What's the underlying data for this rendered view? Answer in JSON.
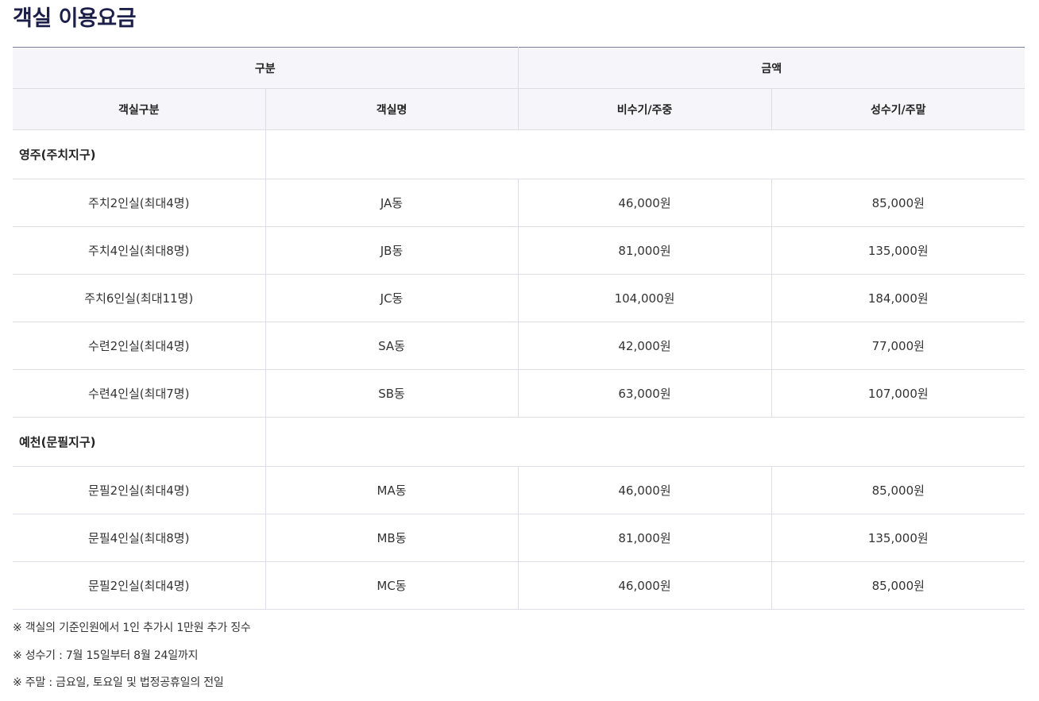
{
  "title": "객실 이용요금",
  "table": {
    "header_top": {
      "category": "구분",
      "amount": "금액"
    },
    "header_sub": {
      "room_type": "객실구분",
      "room_name": "객실명",
      "off_peak": "비수기/주중",
      "peak": "성수기/주말"
    },
    "groups": [
      {
        "name": "영주(주치지구)",
        "rooms": [
          {
            "type": "주치2인실(최대4명)",
            "name": "JA동",
            "off_peak": "46,000원",
            "peak": "85,000원"
          },
          {
            "type": "주치4인실(최대8명)",
            "name": "JB동",
            "off_peak": "81,000원",
            "peak": "135,000원"
          },
          {
            "type": "주치6인실(최대11명)",
            "name": "JC동",
            "off_peak": "104,000원",
            "peak": "184,000원"
          },
          {
            "type": "수련2인실(최대4명)",
            "name": "SA동",
            "off_peak": "42,000원",
            "peak": "77,000원"
          },
          {
            "type": "수련4인실(최대7명)",
            "name": "SB동",
            "off_peak": "63,000원",
            "peak": "107,000원"
          }
        ]
      },
      {
        "name": "예천(문필지구)",
        "rooms": [
          {
            "type": "문필2인실(최대4명)",
            "name": "MA동",
            "off_peak": "46,000원",
            "peak": "85,000원"
          },
          {
            "type": "문필4인실(최대8명)",
            "name": "MB동",
            "off_peak": "81,000원",
            "peak": "135,000원"
          },
          {
            "type": "문필2인실(최대4명)",
            "name": "MC동",
            "off_peak": "46,000원",
            "peak": "85,000원"
          }
        ]
      }
    ]
  },
  "notes": [
    "※ 객실의 기준인원에서 1인 추가시 1만원 추가 징수",
    "※ 성수기 : 7월 15일부터 8월 24일까지",
    "※ 주말 : 금요일, 토요일 및 법정공휴일의 전일"
  ]
}
